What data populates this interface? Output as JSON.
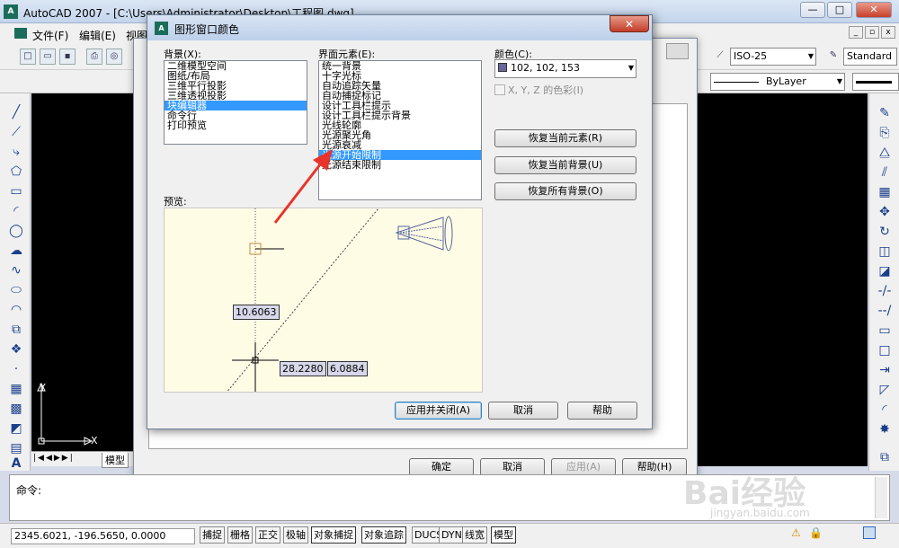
{
  "app": {
    "title": "AutoCAD 2007 - [C:\\Users\\Administrator\\Desktop\\工程图.dwg]",
    "window_buttons": {
      "minimize": "—",
      "maximize": "□",
      "close": "✕"
    }
  },
  "menubar": {
    "items": [
      "文件(F)",
      "编辑(E)",
      "视图"
    ]
  },
  "toolbar": {
    "dimstyle": "ISO-25",
    "textstyle": "Standard",
    "linetype": "ByLayer"
  },
  "drawing": {
    "ucs_y": "Y",
    "ucs_x": "X",
    "model_tab": "模型"
  },
  "options_dialog": {
    "ok": "确定",
    "cancel": "取消",
    "apply": "应用(A)",
    "help": "帮助(H)"
  },
  "color_dialog": {
    "title": "图形窗口颜色",
    "close": "✕",
    "context_label": "背景(X):",
    "contexts": [
      "二维模型空间",
      "图纸/布局",
      "三维平行投影",
      "三维透视投影",
      "块编辑器",
      "命令行",
      "打印预览"
    ],
    "selected_context": 4,
    "element_label": "界面元素(E):",
    "elements": [
      "统一背景",
      "十字光标",
      "自动追踪矢量",
      "自动捕捉标记",
      "设计工具栏提示",
      "设计工具栏提示背景",
      "光线轮廓",
      "光源聚光角",
      "光源衰减",
      "光源开始限制",
      "光源结束限制"
    ],
    "selected_element": 9,
    "color_label": "颜色(C):",
    "color_value": "102, 102, 153",
    "color_hex": "#666699",
    "xyz_label": "X, Y, Z 的色彩(I)",
    "preview_label": "预览:",
    "restore_element": "恢复当前元素(R)",
    "restore_background": "恢复当前背景(U)",
    "restore_all": "恢复所有背景(O)",
    "apply_close": "应用并关闭(A)",
    "cancel": "取消",
    "help": "帮助",
    "preview_values": {
      "v1": "10.6063",
      "v2": "28.2280",
      "v3": "6.0884"
    }
  },
  "command": {
    "prompt": "命令:"
  },
  "status": {
    "coords": "2345.6021, -196.5650, 0.0000",
    "buttons": [
      "捕捉",
      "栅格",
      "正交",
      "极轴",
      "对象捕捉",
      "对象追踪",
      "DUCS",
      "DYN",
      "线宽",
      "模型"
    ]
  },
  "watermark": {
    "main": "Bai经验",
    "sub": "jingyan.baidu.com"
  }
}
